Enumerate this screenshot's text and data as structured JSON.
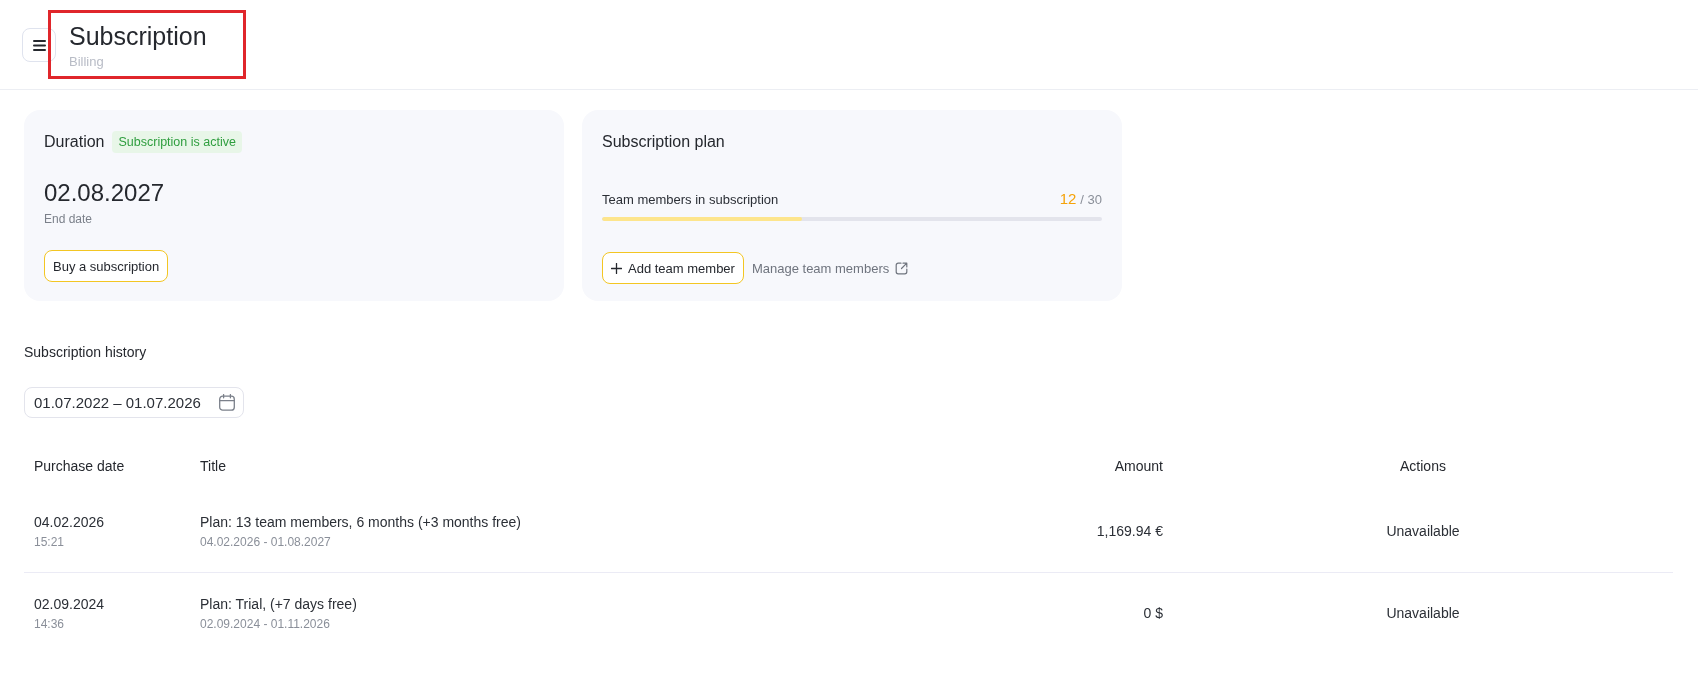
{
  "header": {
    "title": "Subscription",
    "subtitle": "Billing"
  },
  "duration_card": {
    "title": "Duration",
    "badge": "Subscription is active",
    "end_date": "02.08.2027",
    "end_date_label": "End date",
    "button": "Buy a subscription"
  },
  "plan_card": {
    "title": "Subscription plan",
    "meter": {
      "label": "Team members in subscription",
      "count": "12",
      "limit": "/ 30",
      "level": 0.4
    },
    "add_button": "Add team member",
    "manage_link": "Manage team members"
  },
  "history": {
    "title": "Subscription history",
    "date_range": {
      "value": "01.07.2022 – 01.07.2026"
    },
    "table": {
      "columns": [
        "Purchase date",
        "Title",
        "Amount",
        "Actions"
      ],
      "rows": [
        {
          "purchase_date": "04.02.2026",
          "time": "15:21",
          "title": "Plan: 13 team members, 6 months (+3 months free)",
          "period": "04.02.2026 - 01.08.2027",
          "amount": "1,169.94 €",
          "action": "Unavailable"
        },
        {
          "purchase_date": "02.09.2024",
          "time": "14:36",
          "title": "Plan: Trial, (+7 days free)",
          "period": "02.09.2024 - 01.11.2026",
          "amount": "0 $",
          "action": "Unavailable"
        }
      ]
    }
  }
}
